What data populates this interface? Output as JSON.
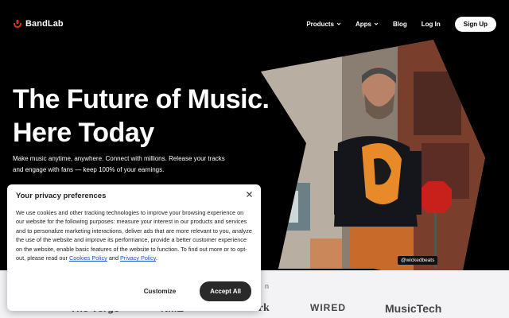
{
  "header": {
    "logo_text": "BandLab",
    "nav": {
      "products_label": "Products",
      "apps_label": "Apps",
      "blog_label": "Blog",
      "login_label": "Log In",
      "signup_label": "Sign Up"
    }
  },
  "hero": {
    "title_line1": "The Future of Music.",
    "title_line2": "Here Today",
    "subtitle_line1": "Make music anytime, anywhere. Connect with millions. Release your tracks",
    "subtitle_line2": "and engage with fans — keep 100% of your earnings.",
    "photo_credit": "@wickedbeats"
  },
  "featured": {
    "caption": "n",
    "logos": [
      "The Verge",
      "NME",
      "Pitchfork",
      "WIRED",
      "MusicTech"
    ]
  },
  "consent": {
    "title": "Your privacy preferences",
    "body_text": "We use cookies and other tracking technologies to improve your browsing experience on our website for the following purposes: measure your interest in our products and services and to personalize marketing interactions, deliver ads that are more relevant to you, analyze the use of the website and improve its performance, provide a better customer experience on the website, enable basic features of the website to function. To find out more or to opt-out, please read our ",
    "cookies_link": "Cookies Policy",
    "and_text": " and ",
    "privacy_link": "Privacy Policy",
    "period": ".",
    "customize_label": "Customize",
    "accept_label": "Accept All"
  },
  "colors": {
    "brand_red": "#e8311a",
    "accept_bg": "#2a2a2a",
    "link": "#1a55c8"
  }
}
